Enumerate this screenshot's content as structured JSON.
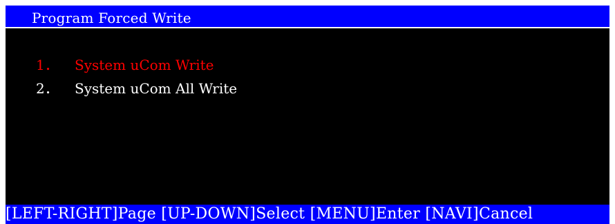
{
  "window": {
    "title": "Program Forced Write"
  },
  "menu": {
    "items": [
      {
        "number": "1．",
        "label": "System uCom Write",
        "selected": true
      },
      {
        "number": "2．",
        "label": "System uCom All Write",
        "selected": false
      }
    ]
  },
  "footer": {
    "hints": [
      {
        "key": "[LEFT-RIGHT]",
        "action": "Page"
      },
      {
        "key": "[UP-DOWN]",
        "action": "Select"
      },
      {
        "key": "[MENU]",
        "action": "Enter"
      },
      {
        "key": "[NAVI]",
        "action": "Cancel"
      }
    ]
  },
  "colors": {
    "background": "#000000",
    "bar": "#0000ff",
    "text": "#ffffff",
    "selected": "#ff0000"
  }
}
